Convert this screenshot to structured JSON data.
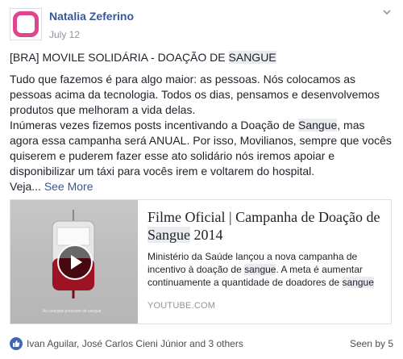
{
  "post": {
    "author": "Natalia Zeferino",
    "date": "July 12",
    "title_prefix": "[BRA] MOVILE SOLIDÁRIA - DOAÇÃO DE ",
    "title_highlight": "SANGUE",
    "body": {
      "line1": "Tudo que fazemos é para algo maior: as pessoas. Nós colocamos as pessoas acima da tecnologia. Todos os dias, pensamos e desenvolvemos produtos que melhoram a vida delas.",
      "line2_prefix": "Inúmeras vezes fizemos posts incentivando a Doação de ",
      "line2_highlight": "Sangue",
      "line2_suffix": ", mas agora essa campanha será ANUAL. Por isso, Movilianos, sempre que vocês quiserem e puderem fazer esse ato solidário nós iremos apoiar e disponibilizar um táxi para vocês irem e voltarem do hospital.",
      "truncated": "Veja...",
      "see_more": "See More"
    }
  },
  "link_card": {
    "title_prefix": "Filme Oficial | Campanha de Doação de ",
    "title_highlight": "Sangue",
    "title_suffix": " 2014",
    "desc_prefix": "Ministério da Saúde lançou a nova campanha de incentivo à doação de ",
    "desc_highlight1": "sangue",
    "desc_middle": ". A meta é aumentar continuamente a quantidade de doadores de ",
    "desc_highlight2": "sangue",
    "domain": "YOUTUBE.COM",
    "thumb_caption": "As cirurgias precisam de sangue"
  },
  "footer": {
    "likers": "Ivan Aguilar, José Carlos Cieni Júnior and 3 others",
    "seen": "Seen by 5"
  },
  "colors": {
    "link_blue": "#365899",
    "avatar_pink": "#e0468f",
    "like_blue": "#4267b2",
    "highlight_bg": "#e9ebee"
  }
}
